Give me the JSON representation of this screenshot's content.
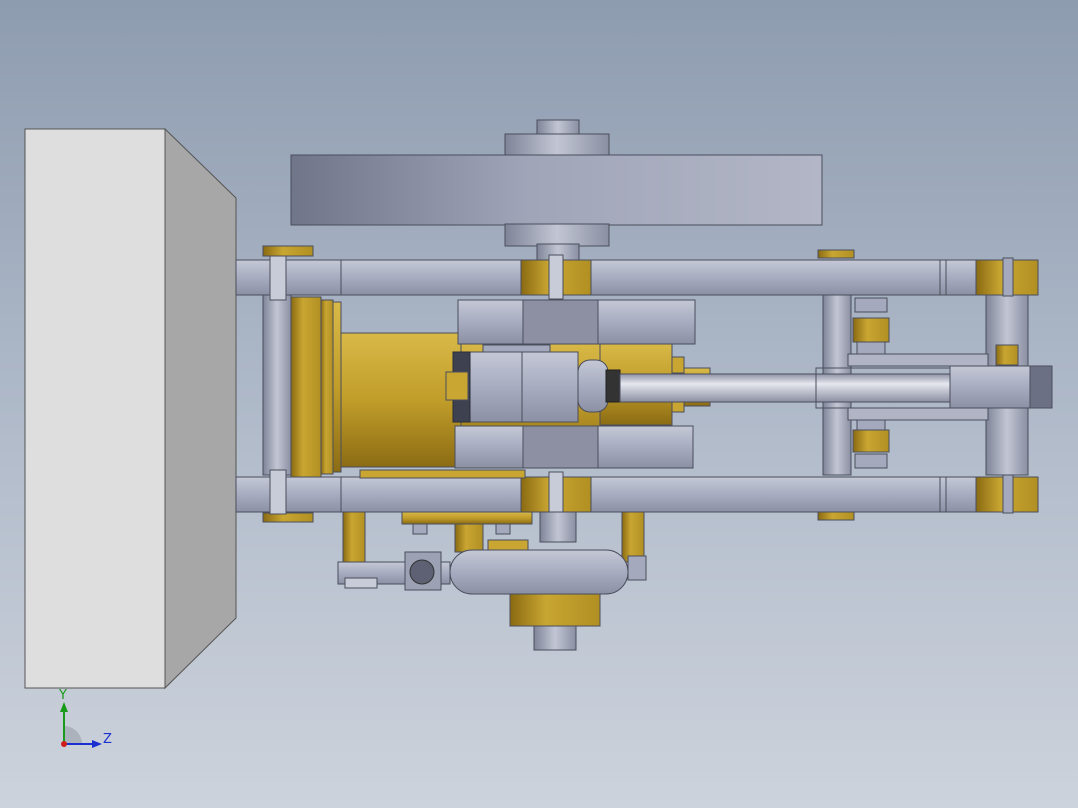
{
  "viewport": {
    "axes": {
      "y_label": "Y",
      "z_label": "Z"
    }
  },
  "colors": {
    "brass": "#c9a632",
    "steel": "#a4a9bd",
    "block_face": "#dedede",
    "block_side": "#a7a7a7",
    "outline": "#4a4e5c"
  },
  "icons": {
    "triad": "coordinate-triad-icon"
  }
}
